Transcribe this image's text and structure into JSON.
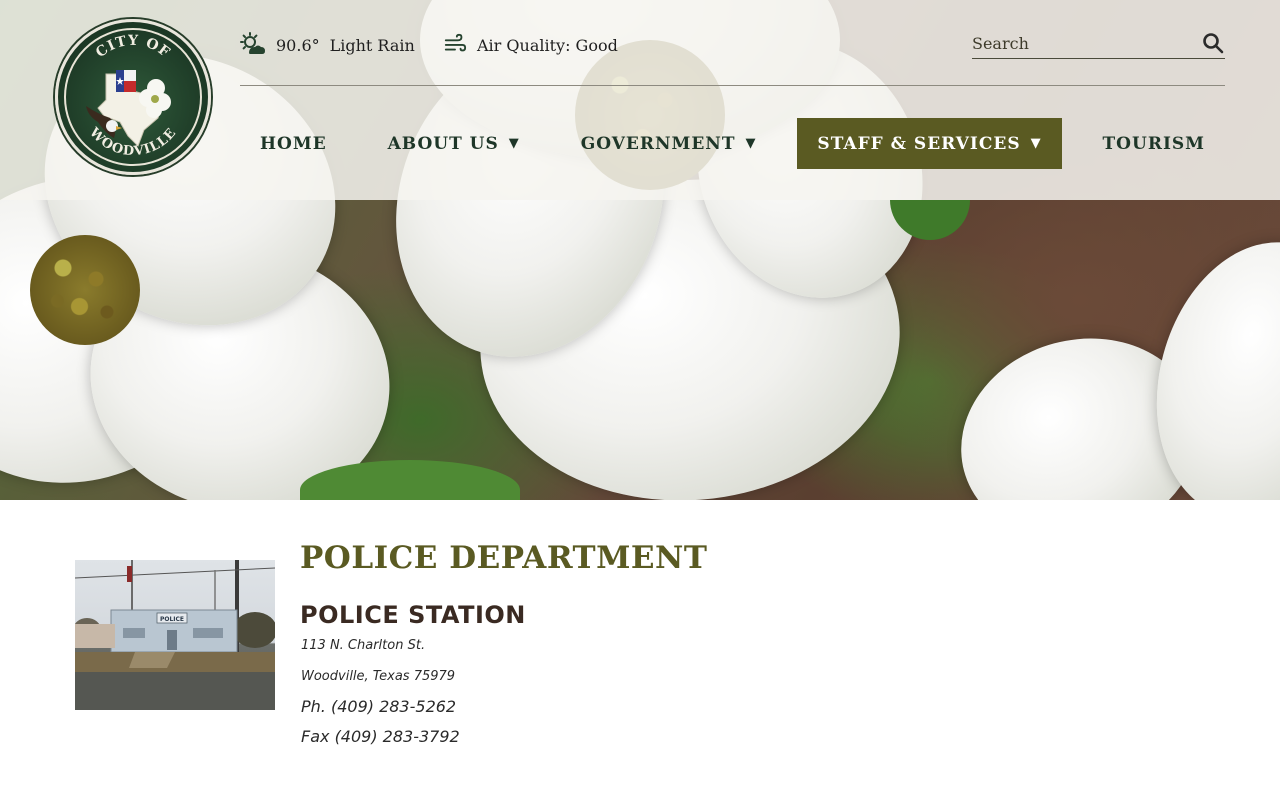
{
  "weather": {
    "icon": "partly-cloudy-icon",
    "temp": "90.6°",
    "condition": "Light Rain"
  },
  "air_quality": {
    "icon": "wind-icon",
    "label": "Air Quality: Good"
  },
  "search": {
    "placeholder": "Search",
    "icon": "search-icon"
  },
  "logo": {
    "top_text": "CITY OF",
    "bottom_text": "WOODVILLE"
  },
  "nav": {
    "items": [
      {
        "label": "HOME",
        "caret": "",
        "active": false
      },
      {
        "label": "ABOUT US",
        "caret": "▼",
        "active": false
      },
      {
        "label": "GOVERNMENT",
        "caret": "▼",
        "active": false
      },
      {
        "label": "STAFF & SERVICES",
        "caret": "▼",
        "active": true
      },
      {
        "label": "TOURISM",
        "caret": "",
        "active": false
      }
    ]
  },
  "content": {
    "page_title": "POLICE DEPARTMENT",
    "section_title": "POLICE STATION",
    "address_line1": "113 N. Charlton St.",
    "address_line2": "Woodville, Texas 75979",
    "phone": "Ph. (409) 283-5262",
    "fax": "Fax (409) 283-3792",
    "photo_sign": "POLICE"
  },
  "colors": {
    "accent": "#5a5a22",
    "nav_text": "#1e3628",
    "section_title": "#3a2a22"
  }
}
